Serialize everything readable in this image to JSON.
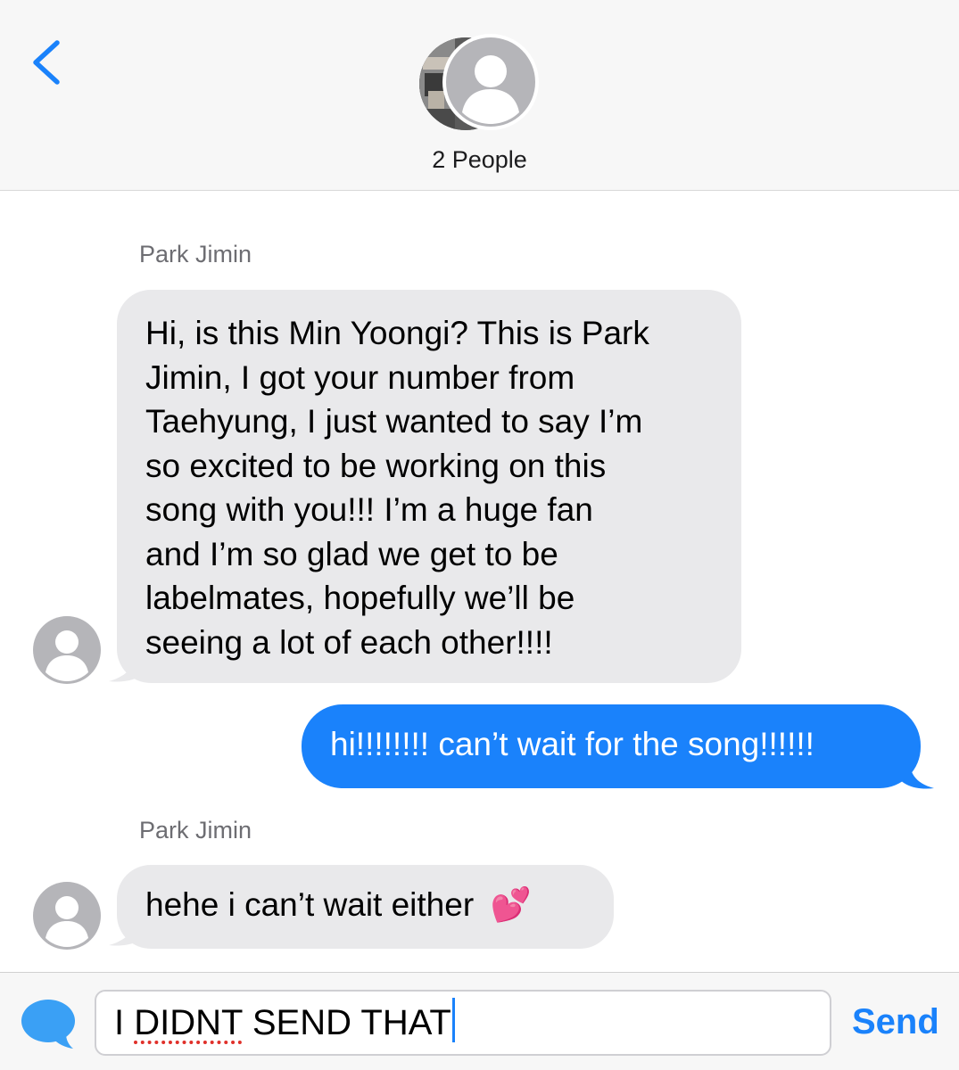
{
  "header": {
    "title": "2 People",
    "back_icon": "chevron-left-icon",
    "accent_color": "#1a82fb"
  },
  "messages": [
    {
      "direction": "incoming",
      "sender": "Park Jimin",
      "lines": [
        "Hi, is this Min Yoongi? This is Park",
        "Jimin, I got your number from",
        "Taehyung, I just wanted to say I’m",
        "so excited to be working on this",
        "song with you!!! I’m a huge fan",
        "and I’m so glad we get to be",
        "labelmates, hopefully we’ll be",
        "seeing a lot of each other!!!!"
      ]
    },
    {
      "direction": "outgoing",
      "text": "hi!!!!!!!! can’t wait for the song!!!!!!"
    },
    {
      "direction": "incoming",
      "sender": "Park Jimin",
      "text": "hehe i can’t wait either",
      "emoji": "💕"
    }
  ],
  "composer": {
    "input_word_1": "I",
    "input_word_2": "DIDNT",
    "input_rest": "SEND THAT",
    "send_label": "Send",
    "apps_icon": "app-store-icon"
  },
  "colors": {
    "incoming_bubble": "#e9e9eb",
    "outgoing_bubble": "#1a82fb",
    "header_bg": "#f7f7f7"
  }
}
